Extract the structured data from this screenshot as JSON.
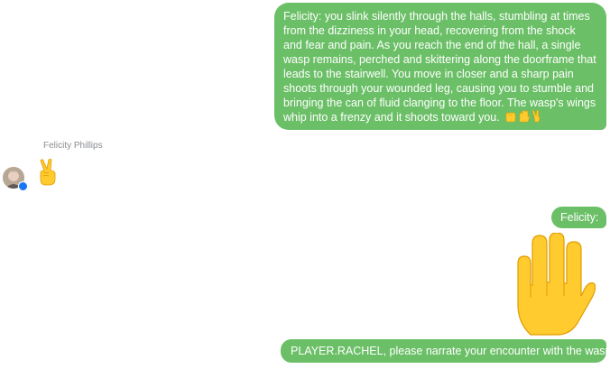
{
  "conversation": {
    "messages": [
      {
        "sender": "Felicity",
        "text": "Felicity: you slink silently through the halls, stumbling at times from the dizziness in your head, recovering from the shock and fear and pain. As you reach the end of the hall, a single wasp remains, perched and skittering along the doorframe that leads to the stairwell. You move in closer and a sharp pain shoots through your wounded leg, causing you to stumble and bringing the can of fluid clanging to the floor. The wasp's wings whip into a frenzy and it shoots toward you.",
        "trailing_emojis": [
          "raised-fist-icon",
          "raised-hand-icon",
          "victory-hand-icon"
        ],
        "direction": "outgoing"
      },
      {
        "sender": "Felicity Phillips",
        "emoji": "victory-hand-icon",
        "direction": "incoming"
      },
      {
        "text": "Felicity:",
        "direction": "outgoing"
      },
      {
        "emoji": "raised-hand-icon",
        "direction": "outgoing"
      },
      {
        "text": "PLAYER.RACHEL, please narrate your encounter with the wasp",
        "direction": "outgoing"
      }
    ],
    "incoming_sender_name": "Felicity Phillips"
  },
  "colors": {
    "outgoing_bubble": "#6bbf67",
    "outgoing_text": "#ffffff",
    "sender_name": "#8a8d91",
    "emoji_yellow": "#ffcb2f",
    "messenger_badge": "#1877f2"
  }
}
